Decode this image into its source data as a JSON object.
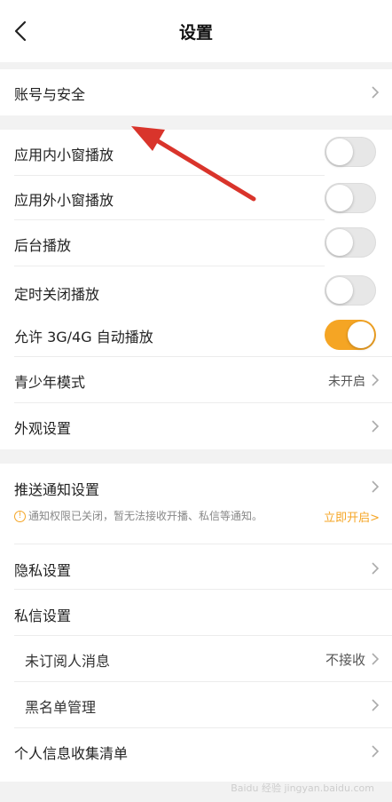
{
  "header": {
    "title": "设置"
  },
  "rows": {
    "account": "账号与安全",
    "pip_in": "应用内小窗播放",
    "pip_out": "应用外小窗播放",
    "background_play": "后台播放",
    "timer_close": "定时关闭播放",
    "autoplay_3g4g": "允许 3G/4G 自动播放",
    "teen_mode": "青少年模式",
    "teen_mode_value": "未开启",
    "appearance": "外观设置",
    "push": "推送通知设置",
    "push_notice": "通知权限已关闭，暂无法接收开播、私信等通知。",
    "push_notice_link": "立即开启>",
    "privacy": "隐私设置",
    "dm": "私信设置",
    "unsub_msgs": "未订阅人消息",
    "unsub_msgs_value": "不接收",
    "blacklist": "黑名单管理",
    "personal_info": "个人信息收集清单"
  },
  "toggles": {
    "pip_in": false,
    "pip_out": false,
    "background_play": false,
    "timer_close": false,
    "autoplay_3g4g": true
  },
  "colors": {
    "accent": "#f5a524",
    "annotation_arrow": "#d9342b"
  },
  "watermark": "Baidu 经验 jingyan.baidu.com"
}
